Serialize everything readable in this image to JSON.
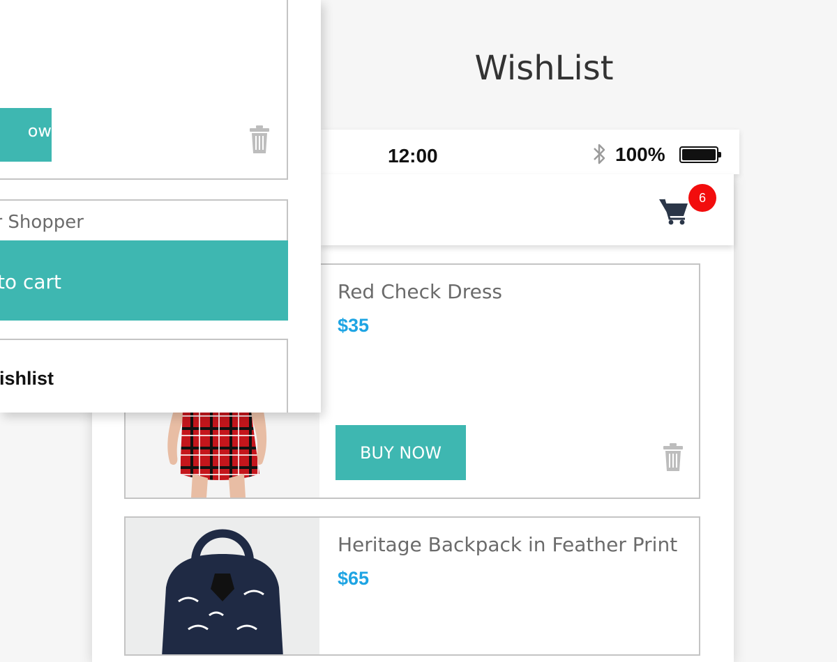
{
  "page": {
    "title": "WishList"
  },
  "status_bar": {
    "time": "12:00",
    "battery": "100%"
  },
  "header": {
    "cart_count": "6"
  },
  "products": [
    {
      "name": "Red Check Dress",
      "price": "$35",
      "buy_label": "BUY NOW"
    },
    {
      "name": "Heritage Backpack in Feather Print",
      "price": "$65"
    }
  ],
  "overlay": {
    "buy_label_partial": "ow",
    "shopper_partial": "r Shopper",
    "add_to_cart_partial": "to cart",
    "wishlist_partial": "wishlist"
  },
  "colors": {
    "accent": "#3eb7b1",
    "price": "#1ea4e3",
    "badge": "#f20d0d",
    "cart_icon": "#2b3648"
  }
}
